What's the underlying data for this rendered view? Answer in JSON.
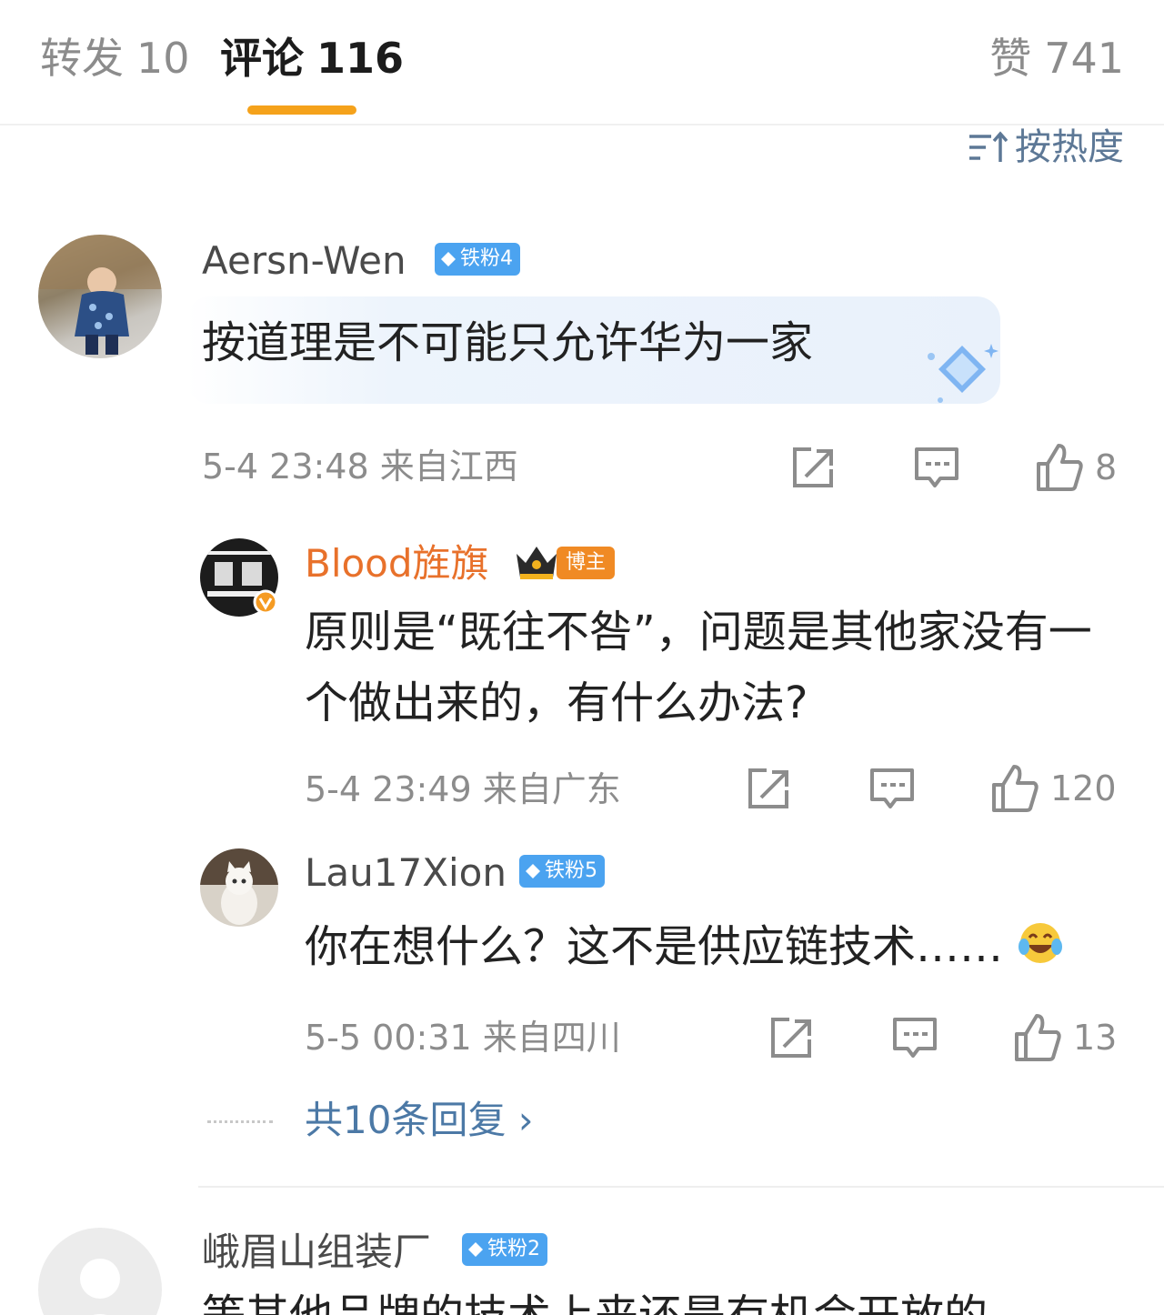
{
  "tabs": {
    "repost_label": "转发",
    "repost_count": "10",
    "comments_label": "评论",
    "comments_count": "116",
    "likes_label": "赞",
    "likes_count": "741",
    "accent_color": "#f5a21b"
  },
  "sort": {
    "icon": "sort-lines-icon",
    "label": "按热度"
  },
  "comments": [
    {
      "user": "Aersn-Wen",
      "badge": "铁粉4",
      "text": "按道理是不可能只允许华为一家",
      "time": "5-4 23:48",
      "location": "来自江西",
      "likes": "8"
    },
    {
      "user": "Blood旌旗",
      "badge": "博主",
      "text": "原则是“既往不咎”，问题是其他家没有一个做出来的，有什么办法?",
      "time": "5-4 23:49",
      "location": "来自广东",
      "likes": "120"
    },
    {
      "user": "Lau17Xion",
      "badge": "铁粉5",
      "text": "你在想什么？这不是供应链技术……",
      "time": "5-5 00:31",
      "location": "来自四川",
      "likes": "13"
    },
    {
      "user": "峨眉山组装厂",
      "badge": "铁粉2",
      "text": "等其他品牌的技术上来还是有机会开放的"
    }
  ],
  "more_replies": "共10条回复 ›",
  "colors": {
    "fan_badge": "#4ba3f0",
    "host_badge": "#f08a24",
    "name_host": "#e8712b",
    "link": "#4c79a6"
  }
}
